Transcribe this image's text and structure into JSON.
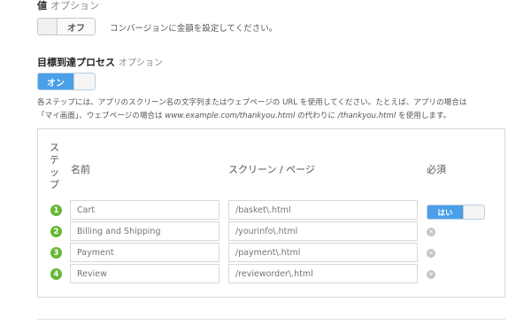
{
  "value_section": {
    "title": "値",
    "option": "オプション",
    "toggle_label": "オフ",
    "help": "コンバージョンに金額を設定してください。"
  },
  "goal_section": {
    "title": "目標到達プロセス",
    "option": "オプション",
    "toggle_label": "オン",
    "desc_1": "各ステップには、アプリのスクリーン名の文字列またはウェブページの URL を使用してください。たとえば、アプリの場合は",
    "desc_2a": "「マイ画面」、ウェブページの場合は ",
    "desc_2b": "www.example.com/thankyou.html",
    "desc_2c": " の代わりに ",
    "desc_2d": "/thankyou.html",
    "desc_2e": " を使用します。"
  },
  "table": {
    "headers": {
      "step": "ステップ",
      "name": "名前",
      "screen": "スクリーン / ページ",
      "required": "必須"
    },
    "rows": [
      {
        "num": "1",
        "name_placeholder": "Cart",
        "screen_placeholder": "/basket\\.html"
      },
      {
        "num": "2",
        "name_placeholder": "Billing and Shipping",
        "screen_placeholder": "/yourinfo\\.html"
      },
      {
        "num": "3",
        "name_placeholder": "Payment",
        "screen_placeholder": "/payment\\.html"
      },
      {
        "num": "4",
        "name_placeholder": "Review",
        "screen_placeholder": "/revieworder\\.html"
      }
    ],
    "required_toggle_label": "はい"
  },
  "colors": {
    "accent": "#4a9fe8",
    "step_badge": "#66b836"
  }
}
